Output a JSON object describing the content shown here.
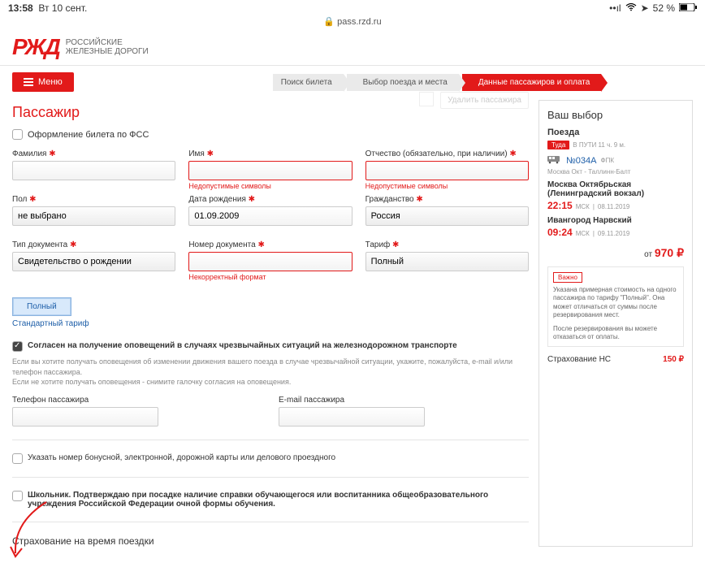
{
  "statusbar": {
    "time": "13:58",
    "date": "Вт 10 сент.",
    "battery": "52 %"
  },
  "url": "pass.rzd.ru",
  "logo": {
    "mark": "РЖД",
    "line1": "Российские",
    "line2": "железные дороги"
  },
  "menu": "Меню",
  "steps": {
    "s1": "Поиск билета",
    "s2": "Выбор поезда и места",
    "s3": "Данные пассажиров и оплата"
  },
  "title": "Пассажир",
  "remove_btn": "Удалить пассажира",
  "fss": {
    "label": "Оформление билета по ФСС"
  },
  "labels": {
    "lastname": "Фамилия",
    "firstname": "Имя",
    "patronymic": "Отчество (обязательно, при наличии)",
    "sex": "Пол",
    "dob": "Дата рождения",
    "citizenship": "Гражданство",
    "doctype": "Тип документа",
    "docnum": "Номер документа",
    "tariff": "Тариф",
    "phone": "Телефон пассажира",
    "email": "E-mail пассажира"
  },
  "values": {
    "sex": "не выбрано",
    "dob": "01.09.2009",
    "citizenship": "Россия",
    "doctype": "Свидетельство о рождении",
    "tariff": "Полный"
  },
  "errors": {
    "invalid_chars": "Недопустимые символы",
    "bad_format": "Некорректный формат"
  },
  "tariff_tabs": {
    "full": "Полный",
    "std": "Стандартный тариф"
  },
  "consent_text": "Согласен на получение оповещений в случаях чрезвычайных ситуаций на железнодорожном транспорте",
  "consent_note": "Если вы хотите получать оповещения об изменении движения вашего поезда в случае чрезвычайной ситуации, укажите, пожалуйста, e-mail и/или телефон пассажира.\nЕсли не хотите получать оповещения - снимите галочку согласия на оповещения.",
  "bonus_label": "Указать номер бонусной, электронной, дорожной карты или делового проездного",
  "school_label": "Школьник. Подтверждаю при посадке наличие справки обучающегося или воспитанника общеобразовательного учреждения Российской Федерации очной формы обучения.",
  "insurance_trip": "Страхование на время поездки",
  "sidebar": {
    "title": "Ваш выбор",
    "sub": "Поезда",
    "tuda": "Туда",
    "travel": "В ПУТИ 11 ч. 9 м.",
    "train_no": "№034А",
    "train_co": "ФПК",
    "route": "Москва Окт - Таллинн-Балт",
    "dep_st": "Москва Октябрьская (Ленинградский вокзал)",
    "dep_time": "22:15",
    "dep_tz": "МСК",
    "dep_date": "08.11.2019",
    "arr_st": "Ивангород Нарвский",
    "arr_time": "09:24",
    "arr_tz": "МСК",
    "arr_date": "09.11.2019",
    "from": "от",
    "price": "970 ₽",
    "warn_badge": "Важно",
    "warn_text": "Указана примерная стоимость на одного пассажира по тарифу \"Полный\". Она может отличаться от суммы после резервирования мест.",
    "reserve_text": "После резервирования вы можете отказаться от оплаты.",
    "ins_label": "Страхование НС",
    "ins_price": "150 ₽"
  }
}
